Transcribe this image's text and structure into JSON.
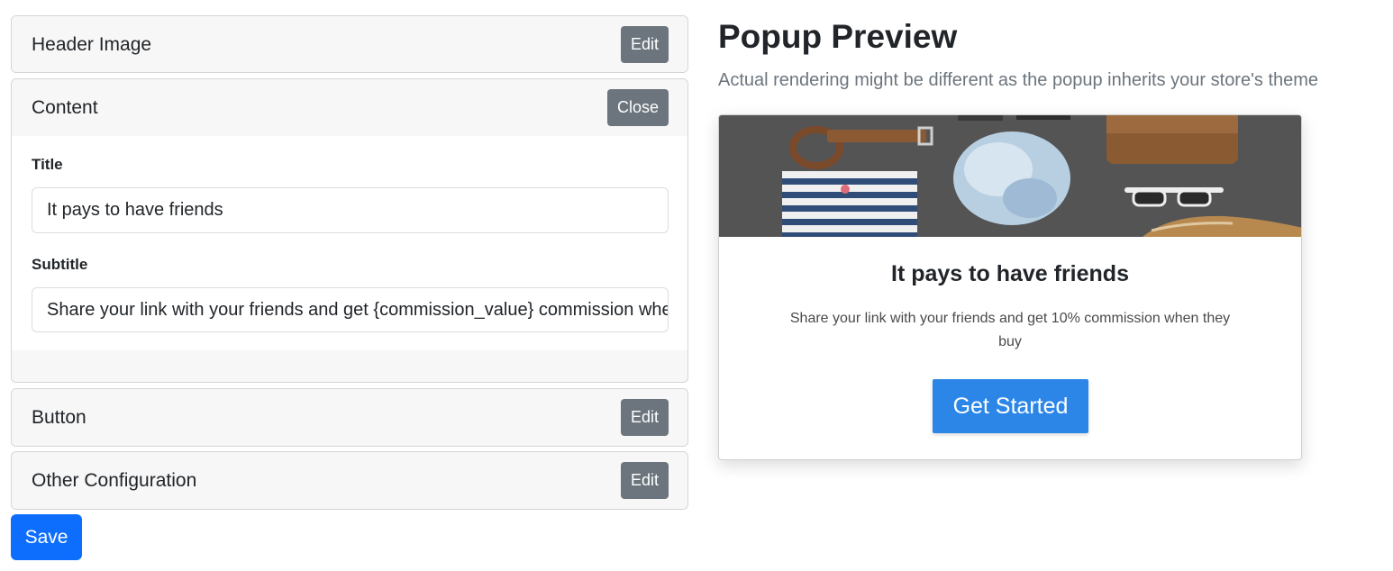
{
  "sections": {
    "header_image": {
      "title": "Header Image",
      "button": "Edit"
    },
    "content": {
      "title": "Content",
      "button": "Close",
      "title_label": "Title",
      "title_value": "It pays to have friends",
      "subtitle_label": "Subtitle",
      "subtitle_value": "Share your link with your friends and get {commission_value} commission when they buy"
    },
    "button": {
      "title": "Button",
      "button": "Edit"
    },
    "other": {
      "title": "Other Configuration",
      "button": "Edit"
    }
  },
  "save_label": "Save",
  "preview": {
    "title": "Popup Preview",
    "subtitle": "Actual rendering might be different as the popup inherits your store's theme",
    "popup": {
      "image": "flat-lay-clothing-accessories-image",
      "heading": "It pays to have friends",
      "text": "Share your link with your friends and get 10% commission when they buy",
      "cta": "Get Started"
    }
  },
  "colors": {
    "primary": "#0d6efd",
    "cta": "#2b86e8",
    "secondary": "#6c757d"
  }
}
